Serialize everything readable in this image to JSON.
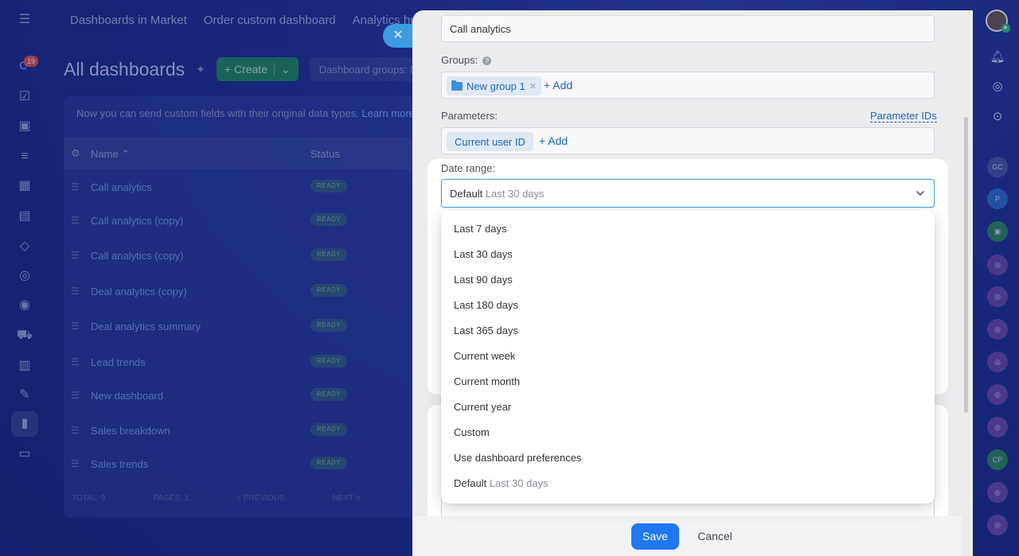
{
  "background": {
    "rail_badge": "19",
    "top_nav": [
      "Dashboards in Market",
      "Order custom dashboard",
      "Analytics hub"
    ],
    "page_title": "All dashboards",
    "create_label": "+ Create",
    "groups_filter": "Dashboard groups: N",
    "notice_text": "Now you can send custom fields with their original data types.",
    "notice_link": "Learn more",
    "columns": {
      "name": "Name",
      "status": "Status"
    },
    "rows": [
      {
        "name": "Call analytics",
        "status": "READY"
      },
      {
        "name": "Call analytics (copy)",
        "status": "READY"
      },
      {
        "name": "Call analytics (copy)",
        "status": "READY"
      },
      {
        "name": "Deal analytics (copy)",
        "status": "READY"
      },
      {
        "name": "Deal analytics summary",
        "status": "READY"
      },
      {
        "name": "Lead trends",
        "status": "READY"
      },
      {
        "name": "New dashboard",
        "status": "READY"
      },
      {
        "name": "Sales breakdown",
        "status": "READY"
      },
      {
        "name": "Sales trends",
        "status": "READY"
      }
    ],
    "footer": [
      "TOTAL: 9",
      "PAGES: 1",
      "< PREVIOUS",
      "NEXT >"
    ],
    "right_rail_labels": {
      "gc": "GC",
      "p": "P",
      "cp": "CP"
    }
  },
  "form": {
    "name_value": "Call analytics",
    "groups_label": "Groups:",
    "group_chip": "New group 1",
    "add_label": "+ Add",
    "parameters_label": "Parameters:",
    "parameter_ids_link": "Parameter IDs",
    "parameter_chip": "Current user ID",
    "date_range_label": "Date range:",
    "date_selected_prefix": "Default",
    "date_selected_value": "Last 30 days"
  },
  "dropdown": {
    "options": [
      "Last 7 days",
      "Last 30 days",
      "Last 90 days",
      "Last 180 days",
      "Last 365 days",
      "Current week",
      "Current month",
      "Current year",
      "Custom",
      "Use dashboard preferences"
    ],
    "default_prefix": "Default",
    "default_value": "Last 30 days"
  },
  "actions": {
    "save": "Save",
    "cancel": "Cancel"
  },
  "colors": {
    "primary": "#1f78f0",
    "link": "#2067b0",
    "focus": "#4fa3d9",
    "backdrop": "#1f2f94"
  }
}
